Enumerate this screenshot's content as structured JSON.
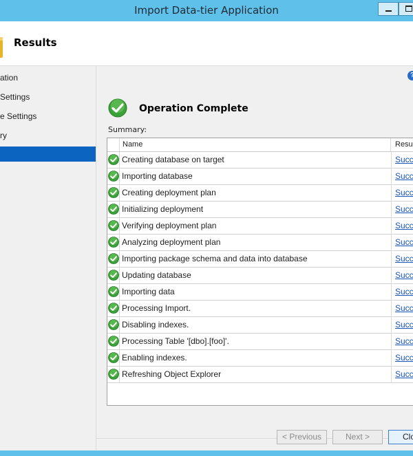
{
  "window": {
    "title": "Import Data-tier Application"
  },
  "header": {
    "title": "Results"
  },
  "sidebar": {
    "items": [
      {
        "label": "ation",
        "active": false
      },
      {
        "label": "Settings",
        "active": false
      },
      {
        "label": "e Settings",
        "active": false
      },
      {
        "label": "ry",
        "active": false
      },
      {
        "label": "",
        "active": true
      }
    ]
  },
  "content": {
    "status_title": "Operation Complete",
    "summary_label": "Summary:",
    "columns": {
      "name": "Name",
      "result": "Resu"
    },
    "rows": [
      {
        "name": "Creating database on target",
        "result": "Succ"
      },
      {
        "name": "Importing database",
        "result": "Succ"
      },
      {
        "name": "Creating deployment plan",
        "result": "Succ"
      },
      {
        "name": "Initializing deployment",
        "result": "Succ"
      },
      {
        "name": "Verifying deployment plan",
        "result": "Succ"
      },
      {
        "name": "Analyzing deployment plan",
        "result": "Succ"
      },
      {
        "name": "Importing package schema and data into database",
        "result": "Succ"
      },
      {
        "name": "Updating database",
        "result": "Succ"
      },
      {
        "name": "Importing data",
        "result": "Succ"
      },
      {
        "name": "Processing Import.",
        "result": "Succ"
      },
      {
        "name": "Disabling indexes.",
        "result": "Succ"
      },
      {
        "name": "Processing Table '[dbo].[foo]'.",
        "result": "Succ"
      },
      {
        "name": "Enabling indexes.",
        "result": "Succ"
      },
      {
        "name": "Refreshing Object Explorer",
        "result": "Succ"
      }
    ]
  },
  "buttons": {
    "previous": "< Previous",
    "next": "Next >",
    "close": "Clo"
  },
  "icons": {
    "success": "check-circle-icon",
    "help": "help-icon",
    "header": "wizard-icon"
  },
  "colors": {
    "titlebar": "#5fc0ea",
    "active_nav": "#0a64c0",
    "link": "#1a55c0",
    "success_green": "#3aa238"
  }
}
